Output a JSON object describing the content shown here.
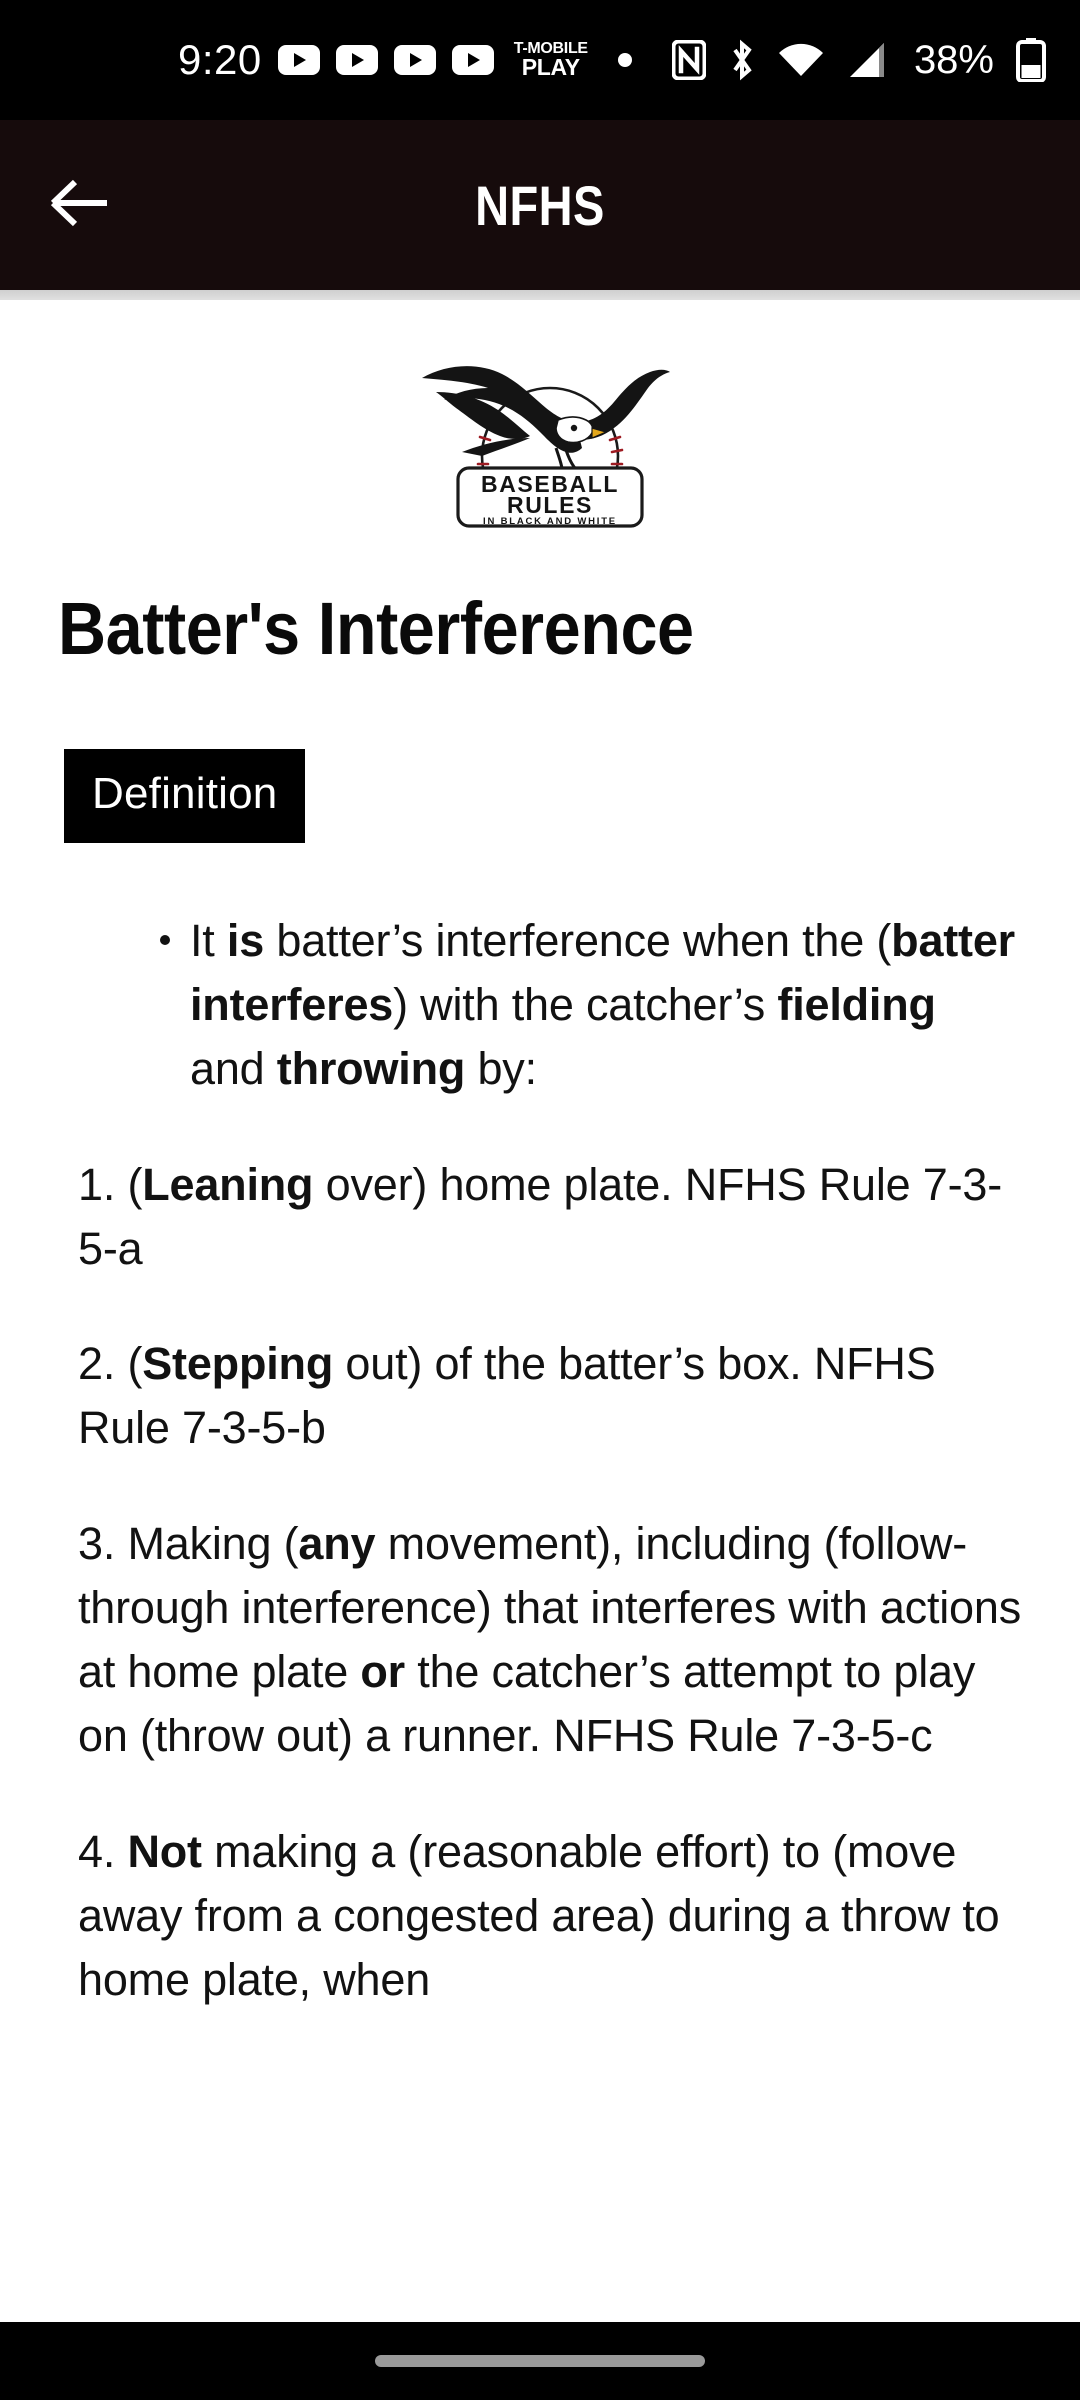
{
  "status_bar": {
    "clock": "9:20",
    "notification_icons": [
      "youtube-icon",
      "youtube-icon",
      "youtube-icon",
      "youtube-icon"
    ],
    "carrier_badge_line1": "T-MOBILE",
    "carrier_badge_line2": "PLAY",
    "overflow_dot": "more-notifications-dot",
    "system_icons": [
      "nfc-icon",
      "bluetooth-icon",
      "wifi-icon",
      "cellular-signal-icon"
    ],
    "battery_percent": "38%",
    "battery_icon": "battery-icon"
  },
  "app_bar": {
    "back_icon": "back-arrow-icon",
    "title": "NFHS",
    "background_color": "#160b0c",
    "title_color": "#ffffff"
  },
  "logo": {
    "name": "baseball-rules-logo",
    "line1": "BASEBALL",
    "line2": "RULES",
    "line3": "IN BLACK AND WHITE"
  },
  "main": {
    "page_title": "Batter's Interference",
    "section_badge": {
      "label": "Definition",
      "background_color": "#000000",
      "text_color": "#ffffff"
    },
    "bullet": {
      "marker": "•",
      "segments": [
        {
          "text": "It ",
          "bold": false
        },
        {
          "text": "is",
          "bold": true
        },
        {
          "text": " batter’s interference when the (",
          "bold": false
        },
        {
          "text": "batter interferes",
          "bold": true
        },
        {
          "text": ") with the catcher’s ",
          "bold": false
        },
        {
          "text": "fielding",
          "bold": true
        },
        {
          "text": " and ",
          "bold": false
        },
        {
          "text": "throwing",
          "bold": true
        },
        {
          "text": " by:",
          "bold": false
        }
      ]
    },
    "numbered_items": [
      {
        "number": "1.",
        "segments": [
          {
            "text": " (",
            "bold": false
          },
          {
            "text": "Leaning",
            "bold": true
          },
          {
            "text": " over) home plate. NFHS Rule 7-3-5-a",
            "bold": false
          }
        ]
      },
      {
        "number": "2.",
        "segments": [
          {
            "text": " (",
            "bold": false
          },
          {
            "text": "Stepping",
            "bold": true
          },
          {
            "text": " out) of the batter’s box. NFHS Rule 7-3-5-b",
            "bold": false
          }
        ]
      },
      {
        "number": "3.",
        "segments": [
          {
            "text": " Making (",
            "bold": false
          },
          {
            "text": "any",
            "bold": true
          },
          {
            "text": " movement), including (follow-through interference) that interferes with actions at home plate ",
            "bold": false
          },
          {
            "text": "or",
            "bold": true
          },
          {
            "text": " the catcher’s attempt to play on (throw out) a runner. NFHS Rule 7-3-5-c",
            "bold": false
          }
        ]
      },
      {
        "number": "4.",
        "segments": [
          {
            "text": " ",
            "bold": false
          },
          {
            "text": "Not",
            "bold": true
          },
          {
            "text": " making a (reasonable effort) to (move away from a congested area) during a throw to home plate, when",
            "bold": false
          }
        ]
      }
    ]
  },
  "nav_bar": {
    "gesture_pill": "home-gesture-pill"
  }
}
